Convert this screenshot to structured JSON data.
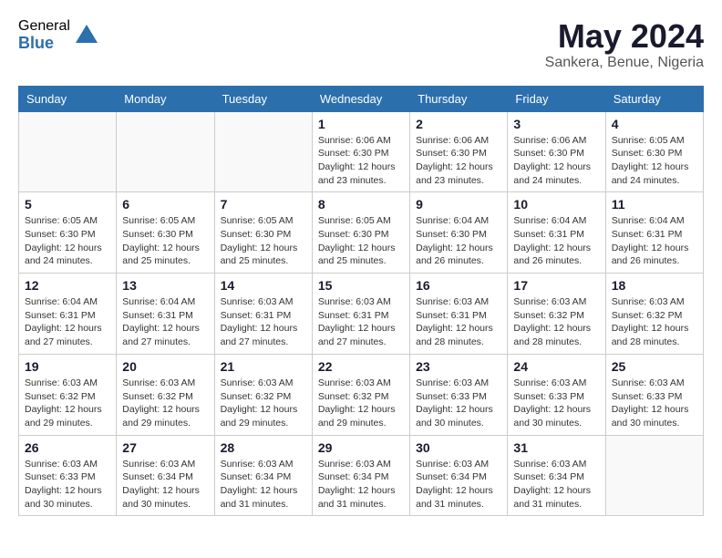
{
  "logo": {
    "general": "General",
    "blue": "Blue"
  },
  "title": {
    "month_year": "May 2024",
    "location": "Sankera, Benue, Nigeria"
  },
  "weekdays": [
    "Sunday",
    "Monday",
    "Tuesday",
    "Wednesday",
    "Thursday",
    "Friday",
    "Saturday"
  ],
  "weeks": [
    [
      {
        "day": "",
        "info": ""
      },
      {
        "day": "",
        "info": ""
      },
      {
        "day": "",
        "info": ""
      },
      {
        "day": "1",
        "info": "Sunrise: 6:06 AM\nSunset: 6:30 PM\nDaylight: 12 hours\nand 23 minutes."
      },
      {
        "day": "2",
        "info": "Sunrise: 6:06 AM\nSunset: 6:30 PM\nDaylight: 12 hours\nand 23 minutes."
      },
      {
        "day": "3",
        "info": "Sunrise: 6:06 AM\nSunset: 6:30 PM\nDaylight: 12 hours\nand 24 minutes."
      },
      {
        "day": "4",
        "info": "Sunrise: 6:05 AM\nSunset: 6:30 PM\nDaylight: 12 hours\nand 24 minutes."
      }
    ],
    [
      {
        "day": "5",
        "info": "Sunrise: 6:05 AM\nSunset: 6:30 PM\nDaylight: 12 hours\nand 24 minutes."
      },
      {
        "day": "6",
        "info": "Sunrise: 6:05 AM\nSunset: 6:30 PM\nDaylight: 12 hours\nand 25 minutes."
      },
      {
        "day": "7",
        "info": "Sunrise: 6:05 AM\nSunset: 6:30 PM\nDaylight: 12 hours\nand 25 minutes."
      },
      {
        "day": "8",
        "info": "Sunrise: 6:05 AM\nSunset: 6:30 PM\nDaylight: 12 hours\nand 25 minutes."
      },
      {
        "day": "9",
        "info": "Sunrise: 6:04 AM\nSunset: 6:30 PM\nDaylight: 12 hours\nand 26 minutes."
      },
      {
        "day": "10",
        "info": "Sunrise: 6:04 AM\nSunset: 6:31 PM\nDaylight: 12 hours\nand 26 minutes."
      },
      {
        "day": "11",
        "info": "Sunrise: 6:04 AM\nSunset: 6:31 PM\nDaylight: 12 hours\nand 26 minutes."
      }
    ],
    [
      {
        "day": "12",
        "info": "Sunrise: 6:04 AM\nSunset: 6:31 PM\nDaylight: 12 hours\nand 27 minutes."
      },
      {
        "day": "13",
        "info": "Sunrise: 6:04 AM\nSunset: 6:31 PM\nDaylight: 12 hours\nand 27 minutes."
      },
      {
        "day": "14",
        "info": "Sunrise: 6:03 AM\nSunset: 6:31 PM\nDaylight: 12 hours\nand 27 minutes."
      },
      {
        "day": "15",
        "info": "Sunrise: 6:03 AM\nSunset: 6:31 PM\nDaylight: 12 hours\nand 27 minutes."
      },
      {
        "day": "16",
        "info": "Sunrise: 6:03 AM\nSunset: 6:31 PM\nDaylight: 12 hours\nand 28 minutes."
      },
      {
        "day": "17",
        "info": "Sunrise: 6:03 AM\nSunset: 6:32 PM\nDaylight: 12 hours\nand 28 minutes."
      },
      {
        "day": "18",
        "info": "Sunrise: 6:03 AM\nSunset: 6:32 PM\nDaylight: 12 hours\nand 28 minutes."
      }
    ],
    [
      {
        "day": "19",
        "info": "Sunrise: 6:03 AM\nSunset: 6:32 PM\nDaylight: 12 hours\nand 29 minutes."
      },
      {
        "day": "20",
        "info": "Sunrise: 6:03 AM\nSunset: 6:32 PM\nDaylight: 12 hours\nand 29 minutes."
      },
      {
        "day": "21",
        "info": "Sunrise: 6:03 AM\nSunset: 6:32 PM\nDaylight: 12 hours\nand 29 minutes."
      },
      {
        "day": "22",
        "info": "Sunrise: 6:03 AM\nSunset: 6:32 PM\nDaylight: 12 hours\nand 29 minutes."
      },
      {
        "day": "23",
        "info": "Sunrise: 6:03 AM\nSunset: 6:33 PM\nDaylight: 12 hours\nand 30 minutes."
      },
      {
        "day": "24",
        "info": "Sunrise: 6:03 AM\nSunset: 6:33 PM\nDaylight: 12 hours\nand 30 minutes."
      },
      {
        "day": "25",
        "info": "Sunrise: 6:03 AM\nSunset: 6:33 PM\nDaylight: 12 hours\nand 30 minutes."
      }
    ],
    [
      {
        "day": "26",
        "info": "Sunrise: 6:03 AM\nSunset: 6:33 PM\nDaylight: 12 hours\nand 30 minutes."
      },
      {
        "day": "27",
        "info": "Sunrise: 6:03 AM\nSunset: 6:34 PM\nDaylight: 12 hours\nand 30 minutes."
      },
      {
        "day": "28",
        "info": "Sunrise: 6:03 AM\nSunset: 6:34 PM\nDaylight: 12 hours\nand 31 minutes."
      },
      {
        "day": "29",
        "info": "Sunrise: 6:03 AM\nSunset: 6:34 PM\nDaylight: 12 hours\nand 31 minutes."
      },
      {
        "day": "30",
        "info": "Sunrise: 6:03 AM\nSunset: 6:34 PM\nDaylight: 12 hours\nand 31 minutes."
      },
      {
        "day": "31",
        "info": "Sunrise: 6:03 AM\nSunset: 6:34 PM\nDaylight: 12 hours\nand 31 minutes."
      },
      {
        "day": "",
        "info": ""
      }
    ]
  ]
}
